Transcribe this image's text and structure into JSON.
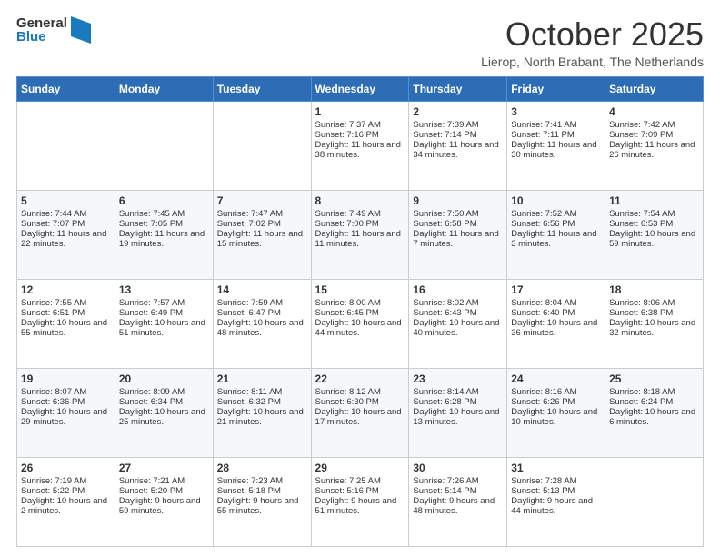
{
  "header": {
    "logo_general": "General",
    "logo_blue": "Blue",
    "month_title": "October 2025",
    "location": "Lierop, North Brabant, The Netherlands"
  },
  "days_of_week": [
    "Sunday",
    "Monday",
    "Tuesday",
    "Wednesday",
    "Thursday",
    "Friday",
    "Saturday"
  ],
  "weeks": [
    [
      {
        "day": "",
        "sunrise": "",
        "sunset": "",
        "daylight": ""
      },
      {
        "day": "",
        "sunrise": "",
        "sunset": "",
        "daylight": ""
      },
      {
        "day": "",
        "sunrise": "",
        "sunset": "",
        "daylight": ""
      },
      {
        "day": "1",
        "sunrise": "Sunrise: 7:37 AM",
        "sunset": "Sunset: 7:16 PM",
        "daylight": "Daylight: 11 hours and 38 minutes."
      },
      {
        "day": "2",
        "sunrise": "Sunrise: 7:39 AM",
        "sunset": "Sunset: 7:14 PM",
        "daylight": "Daylight: 11 hours and 34 minutes."
      },
      {
        "day": "3",
        "sunrise": "Sunrise: 7:41 AM",
        "sunset": "Sunset: 7:11 PM",
        "daylight": "Daylight: 11 hours and 30 minutes."
      },
      {
        "day": "4",
        "sunrise": "Sunrise: 7:42 AM",
        "sunset": "Sunset: 7:09 PM",
        "daylight": "Daylight: 11 hours and 26 minutes."
      }
    ],
    [
      {
        "day": "5",
        "sunrise": "Sunrise: 7:44 AM",
        "sunset": "Sunset: 7:07 PM",
        "daylight": "Daylight: 11 hours and 22 minutes."
      },
      {
        "day": "6",
        "sunrise": "Sunrise: 7:45 AM",
        "sunset": "Sunset: 7:05 PM",
        "daylight": "Daylight: 11 hours and 19 minutes."
      },
      {
        "day": "7",
        "sunrise": "Sunrise: 7:47 AM",
        "sunset": "Sunset: 7:02 PM",
        "daylight": "Daylight: 11 hours and 15 minutes."
      },
      {
        "day": "8",
        "sunrise": "Sunrise: 7:49 AM",
        "sunset": "Sunset: 7:00 PM",
        "daylight": "Daylight: 11 hours and 11 minutes."
      },
      {
        "day": "9",
        "sunrise": "Sunrise: 7:50 AM",
        "sunset": "Sunset: 6:58 PM",
        "daylight": "Daylight: 11 hours and 7 minutes."
      },
      {
        "day": "10",
        "sunrise": "Sunrise: 7:52 AM",
        "sunset": "Sunset: 6:56 PM",
        "daylight": "Daylight: 11 hours and 3 minutes."
      },
      {
        "day": "11",
        "sunrise": "Sunrise: 7:54 AM",
        "sunset": "Sunset: 6:53 PM",
        "daylight": "Daylight: 10 hours and 59 minutes."
      }
    ],
    [
      {
        "day": "12",
        "sunrise": "Sunrise: 7:55 AM",
        "sunset": "Sunset: 6:51 PM",
        "daylight": "Daylight: 10 hours and 55 minutes."
      },
      {
        "day": "13",
        "sunrise": "Sunrise: 7:57 AM",
        "sunset": "Sunset: 6:49 PM",
        "daylight": "Daylight: 10 hours and 51 minutes."
      },
      {
        "day": "14",
        "sunrise": "Sunrise: 7:59 AM",
        "sunset": "Sunset: 6:47 PM",
        "daylight": "Daylight: 10 hours and 48 minutes."
      },
      {
        "day": "15",
        "sunrise": "Sunrise: 8:00 AM",
        "sunset": "Sunset: 6:45 PM",
        "daylight": "Daylight: 10 hours and 44 minutes."
      },
      {
        "day": "16",
        "sunrise": "Sunrise: 8:02 AM",
        "sunset": "Sunset: 6:43 PM",
        "daylight": "Daylight: 10 hours and 40 minutes."
      },
      {
        "day": "17",
        "sunrise": "Sunrise: 8:04 AM",
        "sunset": "Sunset: 6:40 PM",
        "daylight": "Daylight: 10 hours and 36 minutes."
      },
      {
        "day": "18",
        "sunrise": "Sunrise: 8:06 AM",
        "sunset": "Sunset: 6:38 PM",
        "daylight": "Daylight: 10 hours and 32 minutes."
      }
    ],
    [
      {
        "day": "19",
        "sunrise": "Sunrise: 8:07 AM",
        "sunset": "Sunset: 6:36 PM",
        "daylight": "Daylight: 10 hours and 29 minutes."
      },
      {
        "day": "20",
        "sunrise": "Sunrise: 8:09 AM",
        "sunset": "Sunset: 6:34 PM",
        "daylight": "Daylight: 10 hours and 25 minutes."
      },
      {
        "day": "21",
        "sunrise": "Sunrise: 8:11 AM",
        "sunset": "Sunset: 6:32 PM",
        "daylight": "Daylight: 10 hours and 21 minutes."
      },
      {
        "day": "22",
        "sunrise": "Sunrise: 8:12 AM",
        "sunset": "Sunset: 6:30 PM",
        "daylight": "Daylight: 10 hours and 17 minutes."
      },
      {
        "day": "23",
        "sunrise": "Sunrise: 8:14 AM",
        "sunset": "Sunset: 6:28 PM",
        "daylight": "Daylight: 10 hours and 13 minutes."
      },
      {
        "day": "24",
        "sunrise": "Sunrise: 8:16 AM",
        "sunset": "Sunset: 6:26 PM",
        "daylight": "Daylight: 10 hours and 10 minutes."
      },
      {
        "day": "25",
        "sunrise": "Sunrise: 8:18 AM",
        "sunset": "Sunset: 6:24 PM",
        "daylight": "Daylight: 10 hours and 6 minutes."
      }
    ],
    [
      {
        "day": "26",
        "sunrise": "Sunrise: 7:19 AM",
        "sunset": "Sunset: 5:22 PM",
        "daylight": "Daylight: 10 hours and 2 minutes."
      },
      {
        "day": "27",
        "sunrise": "Sunrise: 7:21 AM",
        "sunset": "Sunset: 5:20 PM",
        "daylight": "Daylight: 9 hours and 59 minutes."
      },
      {
        "day": "28",
        "sunrise": "Sunrise: 7:23 AM",
        "sunset": "Sunset: 5:18 PM",
        "daylight": "Daylight: 9 hours and 55 minutes."
      },
      {
        "day": "29",
        "sunrise": "Sunrise: 7:25 AM",
        "sunset": "Sunset: 5:16 PM",
        "daylight": "Daylight: 9 hours and 51 minutes."
      },
      {
        "day": "30",
        "sunrise": "Sunrise: 7:26 AM",
        "sunset": "Sunset: 5:14 PM",
        "daylight": "Daylight: 9 hours and 48 minutes."
      },
      {
        "day": "31",
        "sunrise": "Sunrise: 7:28 AM",
        "sunset": "Sunset: 5:13 PM",
        "daylight": "Daylight: 9 hours and 44 minutes."
      },
      {
        "day": "",
        "sunrise": "",
        "sunset": "",
        "daylight": ""
      }
    ]
  ]
}
